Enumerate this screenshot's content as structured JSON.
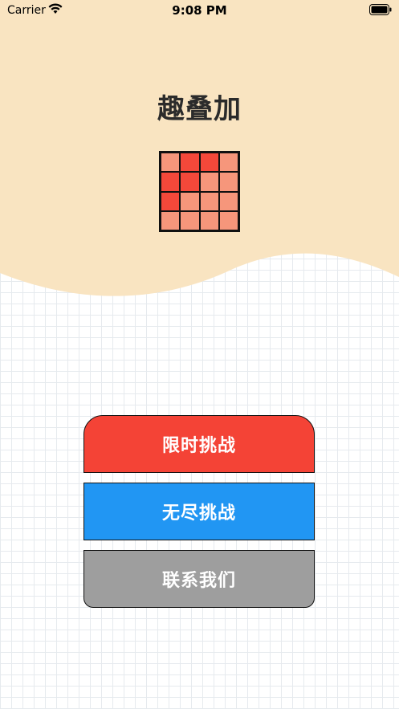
{
  "status_bar": {
    "carrier": "Carrier",
    "time": "9:08 PM",
    "wifi_icon": "wifi-icon",
    "battery_icon": "battery-full-icon"
  },
  "header": {
    "title": "趣叠加",
    "background_color": "#F9E4C1",
    "logo_icon": "color-grid-logo-icon"
  },
  "logo_cells": [
    "#F6967B",
    "#F4483A",
    "#F4483A",
    "#F6967B",
    "#F4483A",
    "#F4483A",
    "#F6967B",
    "#F6967B",
    "#F4483A",
    "#F6967B",
    "#F6967B",
    "#F6967B",
    "#F6967B",
    "#F6967B",
    "#F6967B",
    "#F6967B"
  ],
  "menu": {
    "timed_challenge": {
      "label": "限时挑战",
      "color": "#F44336"
    },
    "endless_challenge": {
      "label": "无尽挑战",
      "color": "#2196F3"
    },
    "contact_us": {
      "label": "联系我们",
      "color": "#9E9E9E"
    }
  }
}
